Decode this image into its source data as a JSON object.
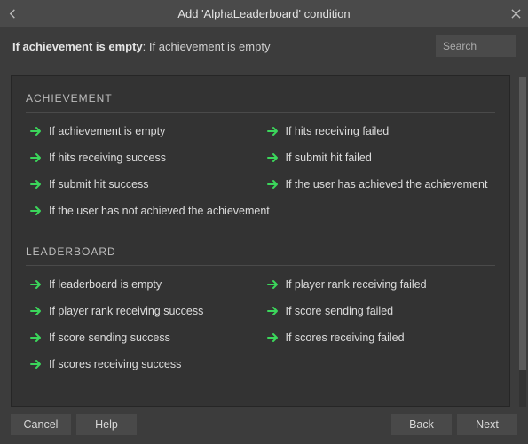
{
  "titlebar": {
    "title": "Add 'AlphaLeaderboard' condition"
  },
  "header": {
    "condition_bold": "If achievement is empty",
    "condition_desc": ": If achievement is empty",
    "search_placeholder": "Search"
  },
  "sections": {
    "achievement": {
      "title": "ACHIEVEMENT",
      "items": [
        "If achievement is empty",
        "If hits receiving failed",
        "If hits receiving success",
        "If submit hit failed",
        "If submit hit success",
        "If the user has achieved the achievement",
        "If the user has not achieved the achievement"
      ]
    },
    "leaderboard": {
      "title": "LEADERBOARD",
      "items": [
        "If leaderboard is empty",
        "If player rank receiving failed",
        "If player rank receiving success",
        "If score sending failed",
        "If score sending success",
        "If scores receiving failed",
        "If scores receiving success"
      ]
    }
  },
  "footer": {
    "cancel": "Cancel",
    "help": "Help",
    "back": "Back",
    "next": "Next"
  },
  "colors": {
    "arrow": "#3bd65b"
  }
}
